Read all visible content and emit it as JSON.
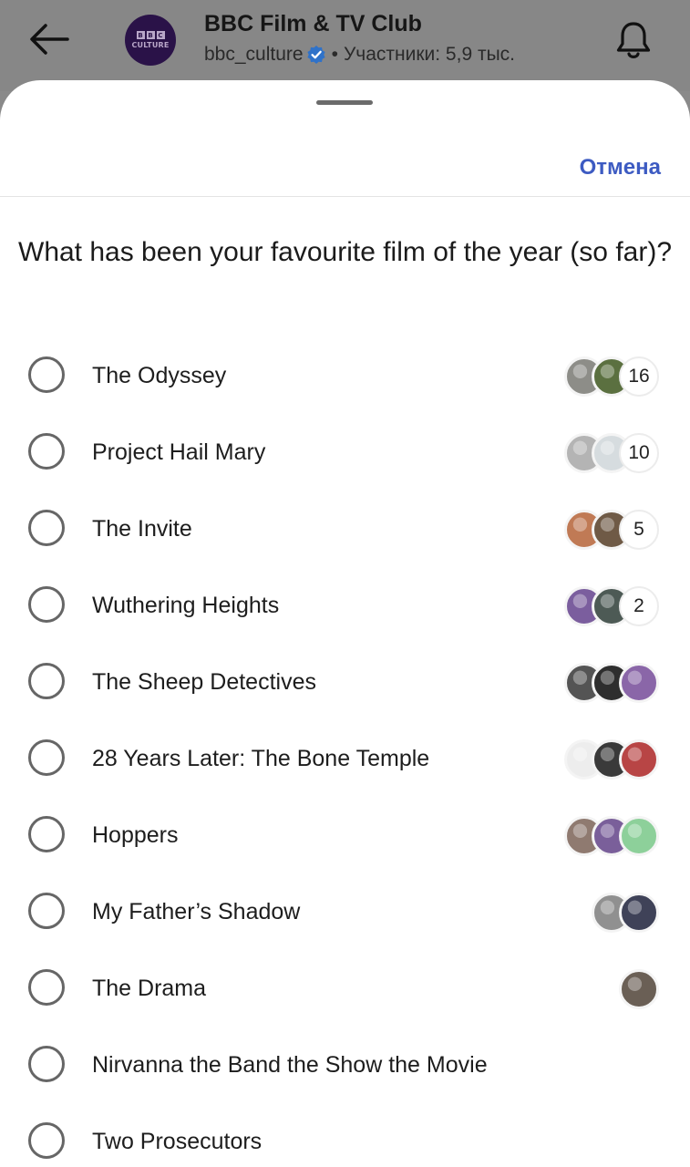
{
  "header": {
    "group_name": "BBC Film & TV Club",
    "handle": "bbc_culture",
    "members": "Участники: 5,9 тыс.",
    "logo_letters": [
      "B",
      "B",
      "C"
    ],
    "logo_sub": "CULTURE",
    "icons": [
      "back-arrow-icon",
      "verified-badge-icon",
      "bell-icon"
    ]
  },
  "sheet": {
    "cancel_label": "Отмена",
    "question": "What has been your favourite film of the year (so far)?"
  },
  "options": [
    {
      "label": "The Odyssey",
      "votes": "16",
      "avatars": [
        "#8d8d88",
        "#5b7040"
      ]
    },
    {
      "label": "Project Hail Mary",
      "votes": "10",
      "avatars": [
        "#b4b4b4",
        "#d6dcdf"
      ]
    },
    {
      "label": "The Invite",
      "votes": "5",
      "avatars": [
        "#c07a55",
        "#6f5a46"
      ]
    },
    {
      "label": "Wuthering Heights",
      "votes": "2",
      "avatars": [
        "#7b5e9e",
        "#4d5a55"
      ]
    },
    {
      "label": "The Sheep Detectives",
      "votes": "",
      "avatars": [
        "#545454",
        "#2e2e2e",
        "#8a66a8"
      ]
    },
    {
      "label": "28 Years Later: The Bone Temple",
      "votes": "",
      "avatars": [
        "#ededed",
        "#3a3a3a",
        "#b84545"
      ]
    },
    {
      "label": "Hoppers",
      "votes": "",
      "avatars": [
        "#8f7a70",
        "#7a5f9a",
        "#8dd09a"
      ]
    },
    {
      "label": "My Father’s Shadow",
      "votes": "",
      "avatars": [
        "#909090",
        "#3f4258"
      ]
    },
    {
      "label": "The Drama",
      "votes": "",
      "avatars": [
        "#6a5f55"
      ]
    },
    {
      "label": "Nirvanna the Band the Show the Movie",
      "votes": "",
      "avatars": []
    },
    {
      "label": "Two Prosecutors",
      "votes": "",
      "avatars": []
    }
  ],
  "colors": {
    "accent": "#3d5bc2",
    "verified": "#2f72c9",
    "logo_bg": "#2a1248"
  }
}
